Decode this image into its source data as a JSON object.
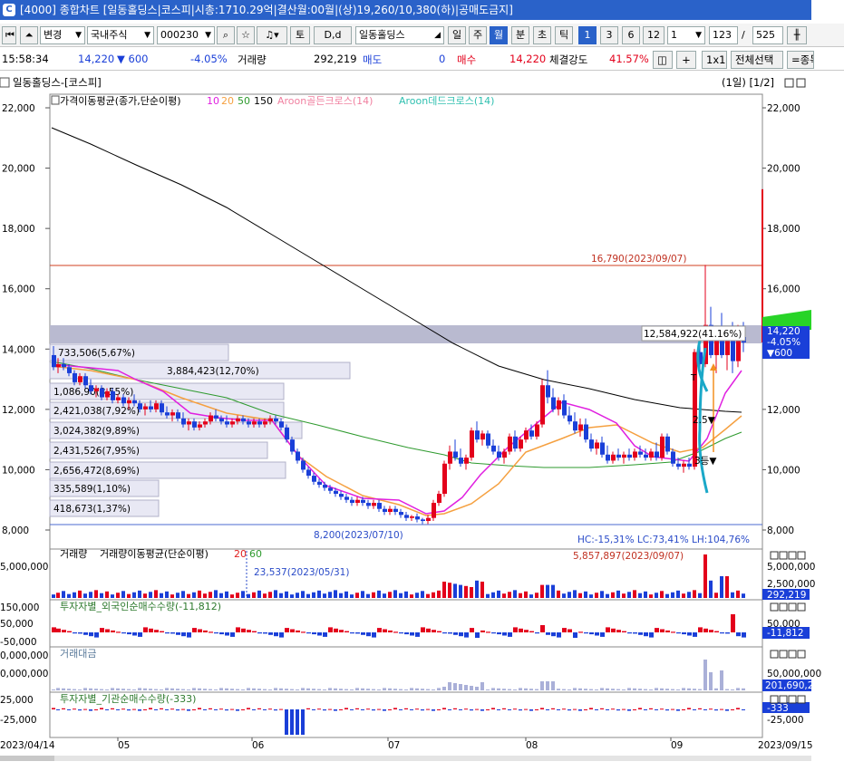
{
  "title": "[4000] 종합차트 [일동홀딩스|코스피|시총:1710.29억|결산월:00월|(상)19,260/10,380(하)|공매도금지]",
  "toolbar": {
    "change_label": "변경",
    "market_select": "국내주식",
    "code_input": "000230",
    "to_label": "토",
    "dd_label": "D,d",
    "name_input": "일동홀딩스",
    "period_day": "일",
    "period_week": "주",
    "period_month": "월",
    "period_minute": "분",
    "period_second": "초",
    "period_tick": "틱",
    "num_1": "1",
    "num_3": "3",
    "num_6": "6",
    "num_12": "12",
    "interval_select": "1",
    "count_123": "123",
    "slash": "/",
    "count_525": "525"
  },
  "infobar": {
    "time": "15:58:34",
    "price": "14,220",
    "change": "▼ 600",
    "change_pct": "-4.05%",
    "volume_label": "거래량",
    "volume": "292,219",
    "ask_label": "매도",
    "ask_value": "0",
    "bid_label": "매수",
    "bid_value": "14,220",
    "strength_label": "체결강도",
    "strength_value": "41.57%",
    "btn_plus": "+",
    "btn_1x1": "1x1",
    "btn_select_all": "전체선택",
    "btn_more": "=종목"
  },
  "chart": {
    "header_title": "일동홀딩스-[코스피]",
    "header_right": "(1일) [1/2]",
    "legend_ma": "가격이동평균(종가,단순이평)",
    "legend_ma_periods": [
      "10",
      "20",
      "50",
      "150"
    ],
    "legend_aroon_gold": "Aroon골든크로스(14)",
    "legend_aroon_dead": "Aroon데드크로스(14)",
    "price_ticks": [
      "22,000",
      "20,000",
      "18,000",
      "16,000",
      "14,000",
      "12,000",
      "10,000",
      "8,000"
    ],
    "high_label": "16,790(2023/09/07)",
    "low_label": "8,200(2023/07/10)",
    "current_price_tag": "14,220",
    "current_pct_tag": "-4.05%",
    "current_chg_tag": "▼600",
    "volume_profile_box": "12,584,922(41.16%)",
    "volume_profile": [
      "733,506(5,67%)",
      "3,884,423(12,70%)",
      "1,086,90(3,55%)",
      "2,421,038(7,92%)",
      "3,024,382(9,89%)",
      "2,431,526(7,95%)",
      "2,656,472(8,69%)",
      "335,589(1,10%)",
      "418,673(1,37%)"
    ],
    "stats": "HC:-15,31%  LC:73,41%  LH:104,76%",
    "marker_25": "2.5▼",
    "marker_3": "3등▼",
    "marker_t": "T",
    "volume_legend": "거래량",
    "volume_ma_legend": "거래량이동평균(단순이평)",
    "volume_ma_periods": [
      "20",
      "60"
    ],
    "volume_ticks": [
      "5,000,000",
      "2,500,000"
    ],
    "volume_low_label": "23,537(2023/05/31)",
    "volume_high_label": "5,857,897(2023/09/07)",
    "volume_current": "292,219",
    "foreign_legend": "투자자별_외국인순매수수량(-11,812)",
    "foreign_ticks": [
      "150,000",
      "50,000",
      "-50,000"
    ],
    "foreign_current": "-11,812",
    "amount_legend": "거래대금",
    "amount_ticks": [
      "50,000,000",
      "0,000,000"
    ],
    "amount_current": "201,690,2",
    "inst_legend": "투자자별_기관순매수수량(-333)",
    "inst_ticks": [
      "25,000",
      "-25,000"
    ],
    "inst_current": "-333",
    "x_labels": [
      "2023/04/14",
      "05",
      "06",
      "07",
      "08",
      "09",
      "2023/09/15"
    ]
  },
  "colors": {
    "up": "#e3001b",
    "down": "#1a3fd8",
    "ma10": "#e020e0",
    "ma20": "#f5a040",
    "ma50": "#2e9a2e",
    "ma150": "#000000",
    "title_bar": "#2a62c9"
  }
}
